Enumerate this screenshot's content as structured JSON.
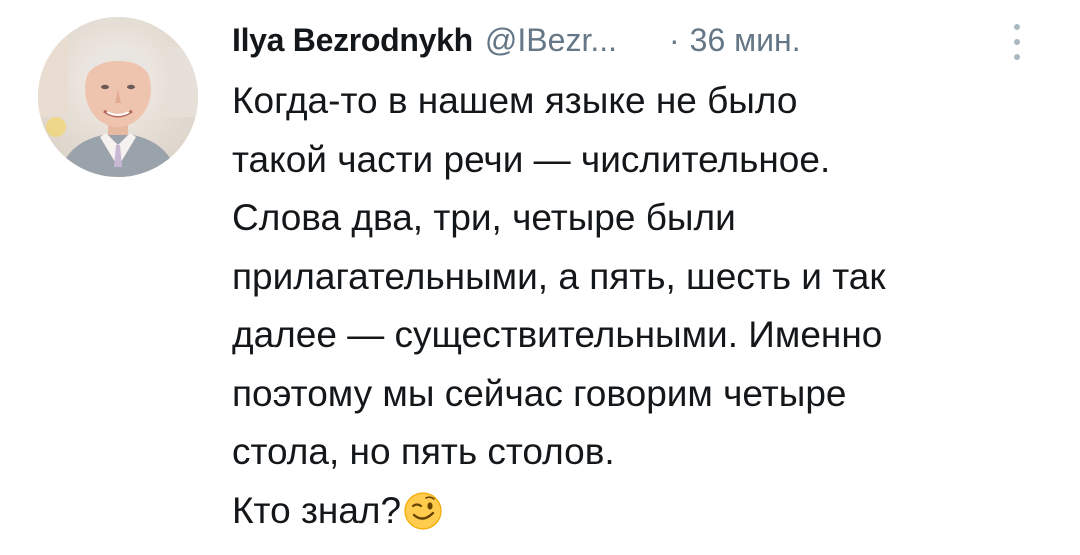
{
  "tweet": {
    "author_name": "Ilya Bezrodnykh",
    "author_handle": "@IBezr...",
    "separator": "·",
    "timestamp": "36 мин.",
    "menu_icon": "more-vertical-icon",
    "avatar_icon": "profile-photo",
    "text_lines": [
      "Когда-то в нашем языке не было",
      "такой части речи — числительное.",
      "Слова два, три, четыре были",
      "прилагательными, а пять, шесть и так",
      "далее — существительными. Именно",
      "поэтому мы сейчас говорим четыре",
      "стола, но пять столов."
    ],
    "last_line": "Кто знал?",
    "emoji": "winking-face-emoji"
  },
  "colors": {
    "text": "#14171a",
    "secondary": "#657786",
    "menu_dots": "#aab8c2",
    "emoji_fill": "#ffcc4d"
  }
}
